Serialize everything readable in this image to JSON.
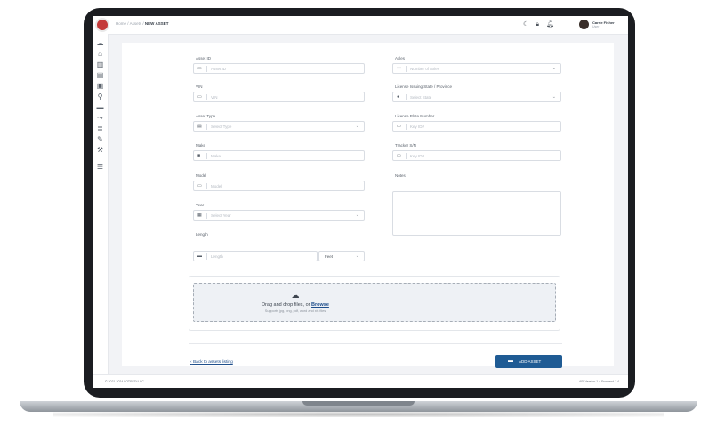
{
  "header": {
    "breadcrumb": [
      "Home",
      "Assets"
    ],
    "breadcrumb_separator": "/",
    "page_title": "NEW ASSET",
    "icons": [
      "moon-icon",
      "lock-icon",
      "bell-icon"
    ],
    "user": {
      "name": "Carrie Fisher",
      "role": "User"
    }
  },
  "sidebar": {
    "icons": [
      "cloud-icon",
      "home-icon",
      "chart-icon",
      "list-icon",
      "car-icon",
      "user-icon",
      "truck-icon",
      "route-icon",
      "doc-icon",
      "edit-icon",
      "wrench-icon",
      "sliders-icon"
    ]
  },
  "form": {
    "left": [
      {
        "label": "Asset ID",
        "placeholder": "Asset ID",
        "icon": "id-icon",
        "select": false
      },
      {
        "label": "VIN",
        "placeholder": "VIN",
        "icon": "id-icon",
        "select": false
      },
      {
        "label": "Asset Type",
        "placeholder": "Select Type",
        "icon": "type-icon",
        "select": true
      },
      {
        "label": "Make",
        "placeholder": "Make",
        "icon": "folder-icon",
        "select": false
      },
      {
        "label": "Model",
        "placeholder": "Model",
        "icon": "id-icon",
        "select": false
      },
      {
        "label": "Year",
        "placeholder": "Select Year",
        "icon": "calendar-icon",
        "select": true
      },
      {
        "label": "Length",
        "placeholder": "Length",
        "icon": "ruler-icon",
        "select": false,
        "unit": "Feet"
      }
    ],
    "right": [
      {
        "label": "Axles",
        "placeholder": "Number of Axles",
        "icon": "axle-icon",
        "select": true
      },
      {
        "label": "License Issuing State / Province",
        "placeholder": "Select State",
        "icon": "pin-icon",
        "select": true
      },
      {
        "label": "License Plate Number",
        "placeholder": "Key ID#",
        "icon": "id-icon",
        "select": false
      },
      {
        "label": "Tracker S/N",
        "placeholder": "Key ID#",
        "icon": "id-icon",
        "select": false
      },
      {
        "label": "Notes",
        "placeholder": "",
        "textarea": true
      }
    ]
  },
  "upload": {
    "text": "Drag and drop files, or",
    "browse": "Browse",
    "hint": "Supports jpg, png, pdf, word and xls files"
  },
  "actions": {
    "back_label": "Back to assets listing",
    "add_label": "ADD ASSET"
  },
  "footer": {
    "left": "© 2021-2024 LOTREDI LLC",
    "right": "API Version 1.4 Frontend 1.4"
  }
}
